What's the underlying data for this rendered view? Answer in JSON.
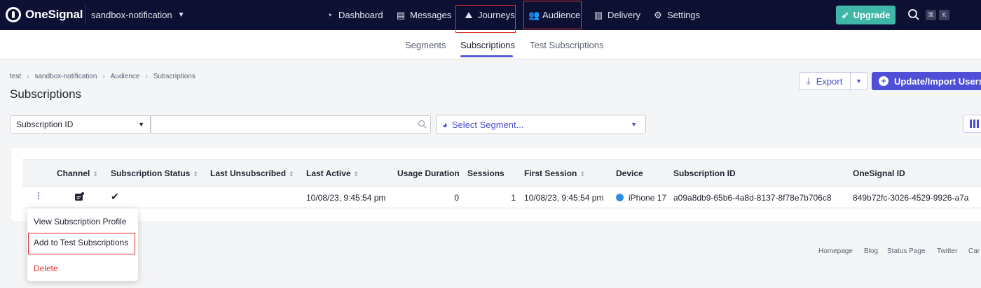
{
  "brand": {
    "name": "OneSignal",
    "accent": "#4f4ed6",
    "nav_bg": "#0d0f33",
    "upgrade_color": "#3fb6a8",
    "highlight": "#e0332c"
  },
  "app_selector": {
    "value": "sandbox-notification"
  },
  "nav": {
    "items": [
      {
        "label": "Dashboard",
        "icon": "gauge-icon"
      },
      {
        "label": "Messages",
        "icon": "chat-icon"
      },
      {
        "label": "Journeys",
        "icon": "journey-icon"
      },
      {
        "label": "Audience",
        "icon": "users-icon",
        "active": true
      },
      {
        "label": "Delivery",
        "icon": "chart-icon"
      },
      {
        "label": "Settings",
        "icon": "gear-icon"
      }
    ],
    "upgrade_label": "Upgrade",
    "shortcut_keys": [
      "⌘",
      "K"
    ]
  },
  "subtabs": [
    {
      "label": "Segments"
    },
    {
      "label": "Subscriptions",
      "active": true
    },
    {
      "label": "Test Subscriptions"
    }
  ],
  "breadcrumb": [
    "test",
    "sandbox-notification",
    "Audience",
    "Subscriptions"
  ],
  "page": {
    "title": "Subscriptions",
    "export_label": "Export",
    "import_label": "Update/Import Users"
  },
  "filters": {
    "field_select": "Subscription ID",
    "search_value": "",
    "segment_placeholder": "Select Segment..."
  },
  "table": {
    "columns": [
      "Channel",
      "Subscription Status",
      "Last Unsubscribed",
      "Last Active",
      "Usage Duration",
      "Sessions",
      "First Session",
      "Device",
      "Subscription ID",
      "OneSignal ID"
    ],
    "rows": [
      {
        "channel_icon": "push-icon",
        "status_icon": "checkmark-icon",
        "last_unsubscribed": "",
        "last_active": "10/08/23, 9:45:54 pm",
        "usage_duration": "0",
        "sessions": "1",
        "first_session": "10/08/23, 9:45:54 pm",
        "device": "iPhone 17",
        "subscription_id": "a09a8db9-65b6-4a8d-8137-8f78e7b706c8",
        "onesignal_id": "849b72fc-3026-4529-9926-a7a"
      }
    ]
  },
  "context_menu": {
    "items": [
      {
        "label": "View Subscription Profile"
      },
      {
        "label": "Add to Test Subscriptions",
        "highlighted": true
      },
      {
        "label": "Delete",
        "danger": true
      }
    ]
  },
  "footer": {
    "links": [
      "Homepage",
      "Blog",
      "Status Page",
      "Twitter",
      "Car"
    ]
  }
}
